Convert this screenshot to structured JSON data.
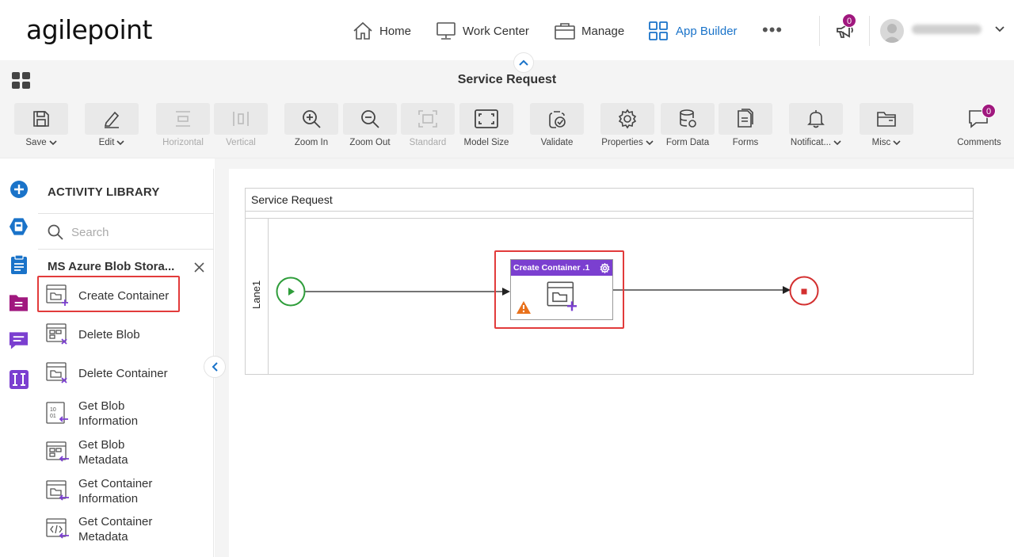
{
  "nav": {
    "logo": "agilepoint",
    "items": [
      {
        "label": "Home",
        "icon": "home-icon"
      },
      {
        "label": "Work Center",
        "icon": "monitor-icon"
      },
      {
        "label": "Manage",
        "icon": "briefcase-icon"
      },
      {
        "label": "App Builder",
        "icon": "grid-icon",
        "active": true
      }
    ],
    "more": "•••",
    "notification_count": "0"
  },
  "page": {
    "title": "Service Request"
  },
  "toolbar": {
    "save": "Save",
    "edit": "Edit",
    "horizontal": "Horizontal",
    "vertical": "Vertical",
    "zoom_in": "Zoom In",
    "zoom_out": "Zoom Out",
    "standard": "Standard",
    "model_size": "Model Size",
    "validate": "Validate",
    "properties": "Properties",
    "form_data": "Form Data",
    "forms": "Forms",
    "notifications": "Notificat...",
    "misc": "Misc",
    "comments": "Comments",
    "comments_count": "0"
  },
  "library": {
    "title": "ACTIVITY LIBRARY",
    "search_placeholder": "Search",
    "category": "MS Azure Blob Stora...",
    "items": [
      {
        "line1": "Create Container",
        "line2": ""
      },
      {
        "line1": "Delete Blob",
        "line2": ""
      },
      {
        "line1": "Delete Container",
        "line2": ""
      },
      {
        "line1": "Get Blob",
        "line2": "Information"
      },
      {
        "line1": "Get Blob",
        "line2": "Metadata"
      },
      {
        "line1": "Get Container",
        "line2": "Information"
      },
      {
        "line1": "Get Container",
        "line2": "Metadata"
      }
    ]
  },
  "canvas": {
    "pool_title": "Service Request",
    "lane": "Lane1",
    "task": {
      "title": "Create Container .1"
    }
  },
  "colors": {
    "accent": "#1a73c9",
    "task_header": "#7b3fd0",
    "highlight": "#e23b3b",
    "start_event": "#2e9d3a",
    "end_event": "#d32f2f",
    "badge": "#a0187e"
  }
}
